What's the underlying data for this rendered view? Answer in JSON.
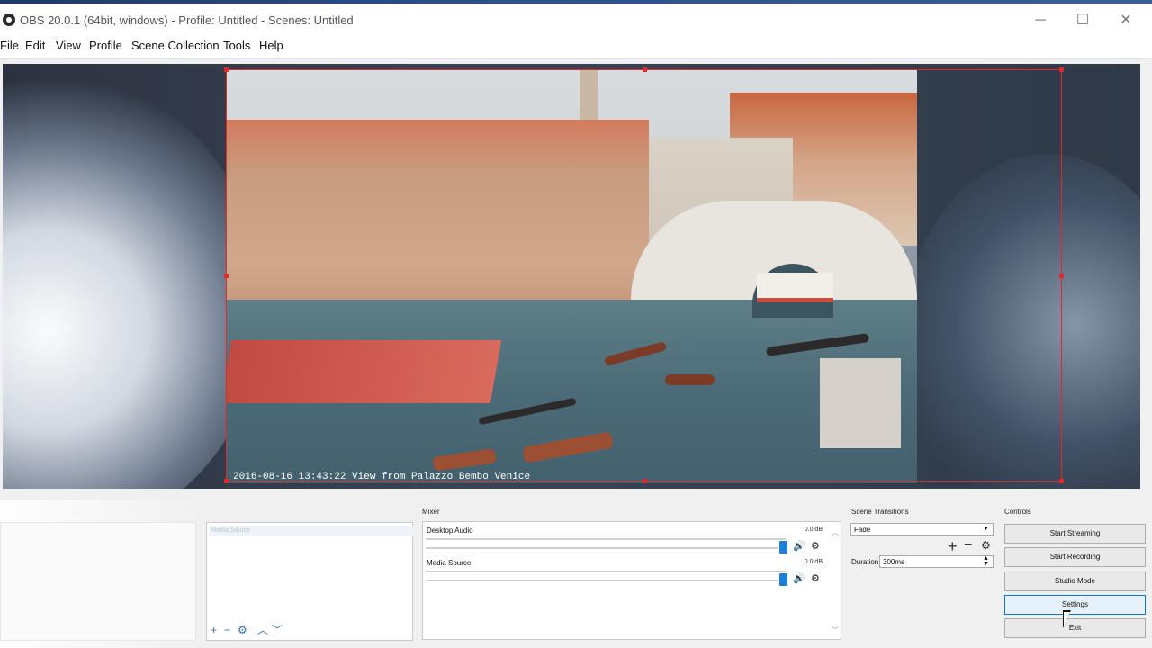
{
  "window": {
    "title": "OBS 20.0.1 (64bit, windows) - Profile: Untitled - Scenes: Untitled",
    "minimize": "─",
    "maximize": "☐",
    "close": "✕"
  },
  "menu": [
    "File",
    "Edit",
    "View",
    "Profile",
    "Scene Collection",
    "Tools",
    "Help"
  ],
  "preview": {
    "caption": "2016-08-16 13:43:22 View from Palazzo Bembo Venice",
    "selection_color": "#e02a2a"
  },
  "sources": {
    "item": "Media Source",
    "icons": {
      "add": "+",
      "remove": "−",
      "settings": "⚙",
      "up": "︿",
      "down": "﹀"
    }
  },
  "mixer": {
    "title": "Mixer",
    "channels": [
      {
        "name": "Desktop Audio",
        "db": "0.0 dB"
      },
      {
        "name": "Media Source",
        "db": "0.0 dB"
      }
    ],
    "speaker_icon": "🔊",
    "gear_icon": "⚙"
  },
  "transitions": {
    "title": "Scene Transitions",
    "selected": "Fade",
    "duration_label": "Duration",
    "duration_value": "300ms",
    "add": "+",
    "remove": "−",
    "settings": "⚙"
  },
  "controls": {
    "title": "Controls",
    "buttons": [
      "Start Streaming",
      "Start Recording",
      "Studio Mode",
      "Settings",
      "Exit"
    ]
  },
  "colors": {
    "accent": "#1e7fd8",
    "selection": "#e02a2a",
    "active_button_border": "#0078d7"
  }
}
